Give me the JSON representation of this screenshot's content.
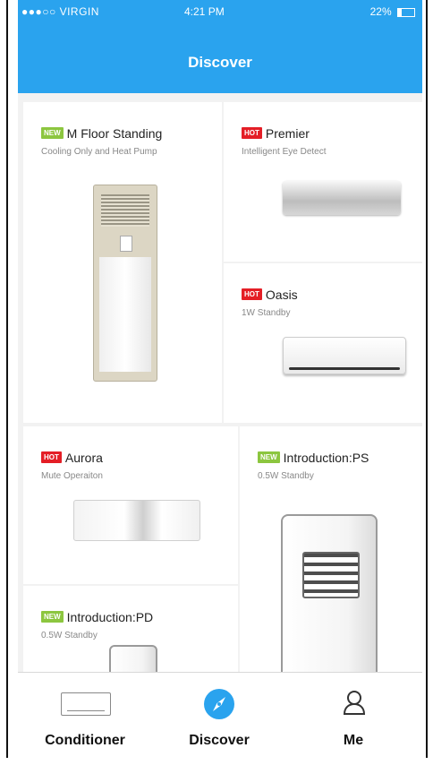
{
  "status_bar": {
    "carrier": "●●●○○ VIRGIN",
    "time": "4:21 PM",
    "battery": "22%"
  },
  "header": {
    "title": "Discover"
  },
  "products": [
    {
      "badge": "NEW",
      "badge_color": "#8cc63f",
      "name": "M Floor Standing",
      "subtitle": "Cooling Only and Heat Pump",
      "icon": "floor-standing-ac"
    },
    {
      "badge": "HOT",
      "badge_color": "#e41e26",
      "name": "Premier",
      "subtitle": "Intelligent Eye Detect",
      "icon": "split-ac-silver"
    },
    {
      "badge": "HOT",
      "badge_color": "#e41e26",
      "name": "Oasis",
      "subtitle": "1W Standby",
      "icon": "split-ac-white"
    },
    {
      "badge": "HOT",
      "badge_color": "#e41e26",
      "name": "Aurora",
      "subtitle": "Mute Operaiton",
      "icon": "split-ac-aurora"
    },
    {
      "badge": "NEW",
      "badge_color": "#8cc63f",
      "name": "Introduction:PS",
      "subtitle": "0.5W Standby",
      "icon": "portable-ac"
    },
    {
      "badge": "NEW",
      "badge_color": "#8cc63f",
      "name": "Introduction:PD",
      "subtitle": "0.5W Standby",
      "icon": "portable-ac"
    }
  ],
  "tabs": [
    {
      "label": "Conditioner",
      "icon": "air-conditioner-icon",
      "active": false
    },
    {
      "label": "Discover",
      "icon": "compass-icon",
      "active": true
    },
    {
      "label": "Me",
      "icon": "person-icon",
      "active": false
    }
  ],
  "colors": {
    "accent": "#2aa3ee",
    "new_badge": "#8cc63f",
    "hot_badge": "#e41e26"
  }
}
